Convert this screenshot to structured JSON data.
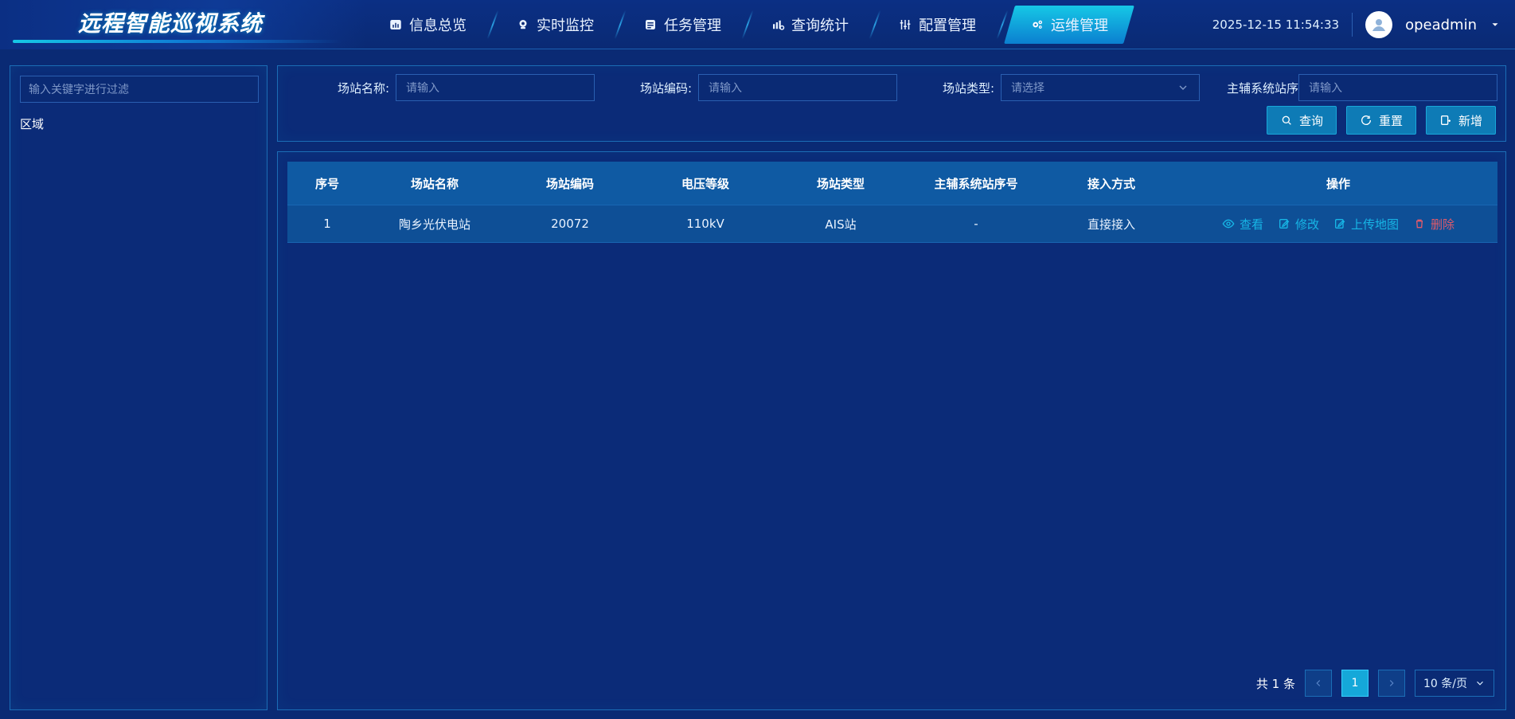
{
  "app": {
    "title": "远程智能巡视系统"
  },
  "nav": {
    "items": [
      {
        "label": "信息总览",
        "icon": "overview-icon"
      },
      {
        "label": "实时监控",
        "icon": "camera-icon"
      },
      {
        "label": "任务管理",
        "icon": "task-icon"
      },
      {
        "label": "查询统计",
        "icon": "stats-icon"
      },
      {
        "label": "配置管理",
        "icon": "sliders-icon"
      },
      {
        "label": "运维管理",
        "icon": "gears-icon",
        "active": true
      }
    ]
  },
  "header": {
    "datetime": "2025-12-15 11:54:33",
    "username": "opeadmin"
  },
  "left_panel": {
    "filter_placeholder": "输入关键字进行过滤",
    "tree_root": "区域"
  },
  "search": {
    "labels": {
      "station_name": "场站名称:",
      "station_code": "场站编码:",
      "station_type": "场站类型:",
      "main_aux_seq": "主辅系统站序号:"
    },
    "placeholders": {
      "station_name": "请输入",
      "station_code": "请输入",
      "station_type": "请选择",
      "main_aux_seq": "请输入"
    },
    "buttons": {
      "query": "查询",
      "reset": "重置",
      "add": "新增"
    }
  },
  "table": {
    "headers": [
      "序号",
      "场站名称",
      "场站编码",
      "电压等级",
      "场站类型",
      "主辅系统站序号",
      "接入方式",
      "操作"
    ],
    "rows": [
      {
        "index": "1",
        "name": "陶乡光伏电站",
        "code": "20072",
        "voltage": "110kV",
        "type": "AIS站",
        "seq": "-",
        "access": "直接接入",
        "actions": {
          "view": "查看",
          "edit": "修改",
          "upload_map": "上传地图",
          "delete": "删除"
        }
      }
    ]
  },
  "pagination": {
    "total": "共 1 条",
    "current_page": "1",
    "page_size": "10 条/页"
  },
  "colors": {
    "accent": "#16c8e6",
    "primary_bg": "#0a2a74",
    "panel_border": "#1b6db6",
    "danger": "#e05a6a"
  }
}
